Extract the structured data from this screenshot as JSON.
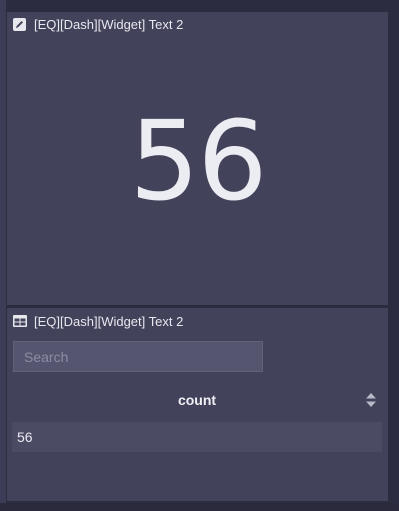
{
  "widgets": [
    {
      "title": "[EQ][Dash][Widget] Text 2",
      "icon": "pencil-icon",
      "value": "56"
    },
    {
      "title": "[EQ][Dash][Widget] Text 2",
      "icon": "table-icon",
      "search": {
        "placeholder": "Search",
        "value": ""
      },
      "table": {
        "columns": [
          "count"
        ],
        "rows": [
          [
            "56"
          ]
        ]
      }
    }
  ],
  "colors": {
    "background": "#2c2c40",
    "panel": "#42425a",
    "row": "#4b4b64",
    "text": "#e7e7ee"
  }
}
